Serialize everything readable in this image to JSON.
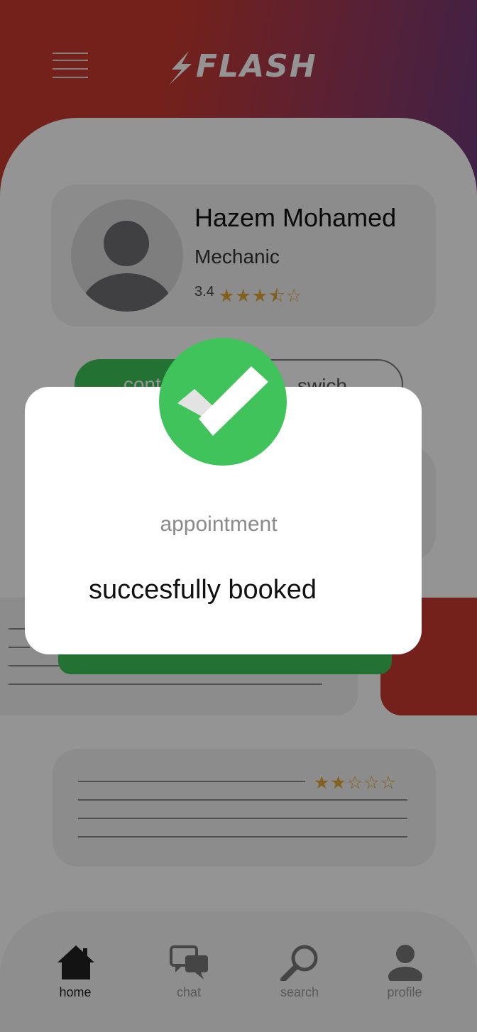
{
  "header": {
    "logo_text": "FLASH"
  },
  "profile": {
    "name": "Hazem Mohamed",
    "role": "Mechanic",
    "rating": "3.4",
    "stars": "★★★⯪☆"
  },
  "actions": {
    "contact_label": "contact",
    "switch_label": "swich"
  },
  "review": {
    "stars": "★★☆☆☆"
  },
  "nav": {
    "items": [
      {
        "label": "home",
        "icon": "home-icon",
        "active": true
      },
      {
        "label": "chat",
        "icon": "chat-icon",
        "active": false
      },
      {
        "label": "search",
        "icon": "search-icon",
        "active": false
      },
      {
        "label": "profile",
        "icon": "profile-icon",
        "active": false
      }
    ]
  },
  "dialog": {
    "title": "appointment",
    "message": "succesfully booked",
    "icon": "checkmark-icon"
  },
  "colors": {
    "brand_red": "#c9392f",
    "brand_purple": "#6d3a7a",
    "success_green": "#3fc35a",
    "star_gold": "#e0a83a"
  }
}
